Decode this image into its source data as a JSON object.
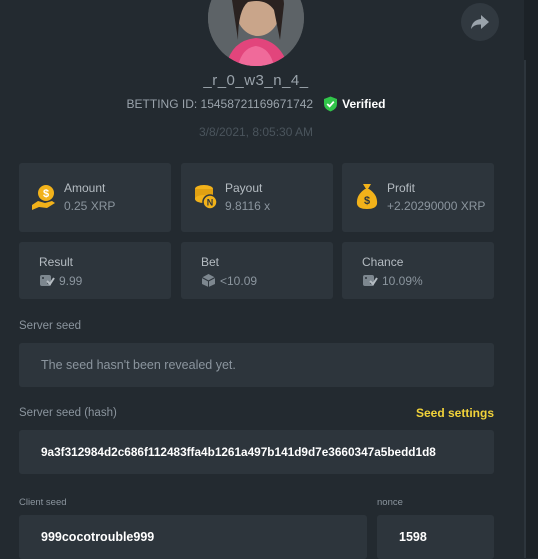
{
  "profile": {
    "username": "_r_0_w3_n_4_",
    "betting_id_label": "BETTING ID: 15458721169671742",
    "verified_label": "Verified",
    "timestamp": "3/8/2021, 8:05:30 AM"
  },
  "stats_top": [
    {
      "label": "Amount",
      "value": "0.25 XRP",
      "icon": "dollar-hand-icon"
    },
    {
      "label": "Payout",
      "value": "9.8116 x",
      "icon": "coin-stack-icon"
    },
    {
      "label": "Profit",
      "value": "+2.20290000 XRP",
      "icon": "money-bag-icon"
    }
  ],
  "stats_bottom": [
    {
      "label": "Result",
      "value": "9.99",
      "icon": "dice-check-icon"
    },
    {
      "label": "Bet",
      "value": "<10.09",
      "icon": "dice-icon"
    },
    {
      "label": "Chance",
      "value": "10.09%",
      "icon": "dice-check-icon"
    }
  ],
  "server_seed": {
    "label": "Server seed",
    "value": "The seed hasn't been revealed yet."
  },
  "server_seed_hash": {
    "label": "Server seed (hash)",
    "value": "9a3f312984d2c686f112483ffa4b1261a497b141d9d7e3660347a5bedd1d8",
    "settings_label": "Seed settings"
  },
  "client_seed": {
    "label": "Client seed",
    "value": "999cocotrouble999"
  },
  "nonce": {
    "label": "nonce",
    "value": "1598"
  },
  "colors": {
    "background": "#232a30",
    "card": "#2d353c",
    "accent_yellow": "#f2d33a",
    "verified_green": "#31c54a"
  }
}
